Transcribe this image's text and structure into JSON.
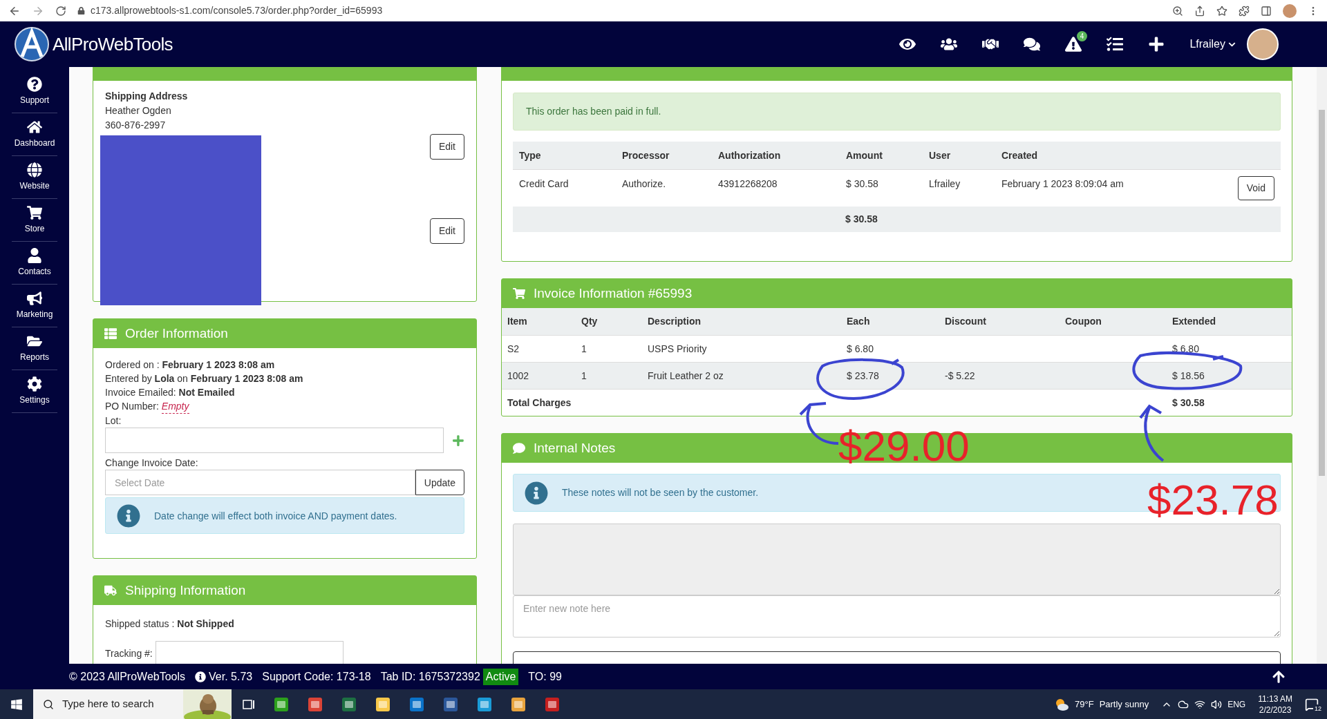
{
  "browser": {
    "url": "c173.allprowebtools-s1.com/console5.73/order.php?order_id=65993"
  },
  "header": {
    "logo": "AllProWebTools",
    "alert_badge": "4",
    "user": "Lfrailey"
  },
  "sidebar": {
    "items": [
      {
        "label": "Support"
      },
      {
        "label": "Dashboard"
      },
      {
        "label": "Website"
      },
      {
        "label": "Store"
      },
      {
        "label": "Contacts"
      },
      {
        "label": "Marketing"
      },
      {
        "label": "Reports"
      },
      {
        "label": "Settings"
      }
    ]
  },
  "buyer": {
    "heading": "Shipping Address",
    "name": "Heather Ogden",
    "phone": "360-876-2997",
    "buttons": [
      "Edit",
      "Edit"
    ]
  },
  "order": {
    "title": "Order Information",
    "lines": [
      "Ordered on : **February 1 2023 8:08 am**",
      "Entered by **Lola** on **February 1 2023 8:08 am**",
      "Invoice Emailed: **Not Emailed**"
    ],
    "po_label": "PO Number:",
    "po_value": "Empty",
    "lot_label": "Lot:",
    "date_label": "Change Invoice Date:",
    "date_placeholder": "Select Date",
    "update_button": "Update",
    "info": "Date change will effect both invoice AND payment dates."
  },
  "shipping": {
    "title": "Shipping Information",
    "status": "Shipped status : **Not Shipped**",
    "tracking_label": "Tracking #:"
  },
  "payment": {
    "alert": "This order has been paid in full.",
    "columns": [
      "Type",
      "Processor",
      "Authorization",
      "Amount",
      "User",
      "Created"
    ],
    "rows": [
      {
        "cells": [
          "Credit Card",
          "Authorize.",
          "43912268208",
          "$ 30.58",
          "Lfrailey",
          "February 1 2023 8:09:04 am"
        ],
        "action": "Void"
      }
    ],
    "total": "$ 30.58"
  },
  "invoice": {
    "title": "Invoice Information #65993",
    "columns": [
      "Item",
      "Qty",
      "Description",
      "Each",
      "Discount",
      "Coupon",
      "Extended"
    ],
    "rows": [
      {
        "cells": [
          "S2",
          "1",
          "USPS Priority",
          "$ 6.80",
          "",
          "",
          "$ 6.80"
        ]
      },
      {
        "cells": [
          "1002",
          "1",
          "Fruit Leather 2 oz",
          "$ 23.78",
          "-$ 5.22",
          "",
          "$ 18.56"
        ]
      }
    ],
    "total_label": "Total Charges",
    "total": "$ 30.58"
  },
  "notes": {
    "title": "Internal Notes",
    "info": "These notes will not be seen by the customer.",
    "placeholder": "Enter new note here"
  },
  "annotations": [
    "$29.00",
    "$23.78"
  ],
  "footer": {
    "copyright": "© 2023 AllProWebTools",
    "version": "Ver. 5.73",
    "support_code": "Support Code: 173-18",
    "tab_id": "Tab ID: 1675372392",
    "status": "Active",
    "timeout": "TO: 99"
  },
  "taskbar": {
    "search_placeholder": "Type here to search",
    "temperature": "79°F",
    "weather": "Partly sunny",
    "language": "ENG",
    "time": "11:13 AM",
    "date": "2/2/2023",
    "notifications": "12"
  }
}
